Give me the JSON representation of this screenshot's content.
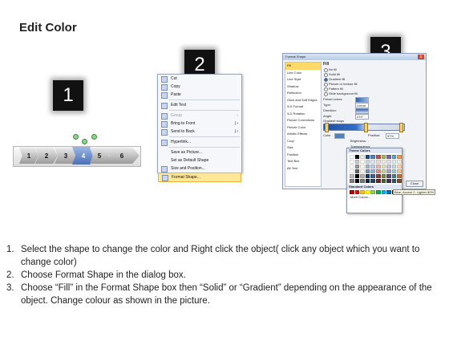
{
  "title": "Edit Color",
  "steps": [
    "1",
    "2",
    "3"
  ],
  "shapes": {
    "labels": [
      "1",
      "2",
      "3",
      "4",
      "5",
      "6"
    ]
  },
  "context_menu": {
    "items": [
      {
        "label": "Cut",
        "shortcut_letter": "t",
        "disabled": false
      },
      {
        "label": "Copy",
        "disabled": false
      },
      {
        "label": "Paste",
        "disabled": false
      },
      {
        "label": "Edit Text",
        "disabled": false
      },
      {
        "label": "Group",
        "disabled": true,
        "submenu": true
      },
      {
        "label": "Bring to Front",
        "disabled": false,
        "submenu": true
      },
      {
        "label": "Send to Back",
        "disabled": false,
        "submenu": true
      },
      {
        "label": "Hyperlink...",
        "disabled": false
      },
      {
        "label": "Save as Picture...",
        "disabled": false
      },
      {
        "label": "Set as Default Shape",
        "disabled": false
      },
      {
        "label": "Size and Position...",
        "disabled": false
      },
      {
        "label": "Format Shape...",
        "disabled": false,
        "highlighted": true
      }
    ]
  },
  "dialog": {
    "title": "Format Shape",
    "close": "x",
    "sidebar": [
      "Fill",
      "Line Color",
      "Line Style",
      "Shadow",
      "Reflection",
      "Glow and Soft Edges",
      "3-D Format",
      "3-D Rotation",
      "Picture Corrections",
      "Picture Color",
      "Artistic Effects",
      "Crop",
      "Size",
      "Position",
      "Text Box",
      "Alt Text"
    ],
    "fill_heading": "Fill",
    "fill_options": [
      {
        "label": "No fill",
        "on": false
      },
      {
        "label": "Solid fill",
        "on": false
      },
      {
        "label": "Gradient fill",
        "on": true
      },
      {
        "label": "Picture or texture fill",
        "on": false
      },
      {
        "label": "Pattern fill",
        "on": false
      },
      {
        "label": "Slide background fill",
        "on": false
      }
    ],
    "fields": [
      {
        "label": "Preset colors:",
        "value": ""
      },
      {
        "label": "Type:",
        "value": "Linear"
      },
      {
        "label": "Direction:",
        "value": ""
      },
      {
        "label": "Angle:",
        "value": "270°"
      }
    ],
    "gradient_stops_label": "Gradient stops",
    "color_label": "Color",
    "position_label": "Position:",
    "position_value": "57%",
    "brightness_label": "Brightness:",
    "transparency_label": "Transparency:",
    "rotate_label": "Rotate with shape",
    "close_button": "Close"
  },
  "palette": {
    "theme_label": "Theme Colors",
    "standard_label": "Standard Colors",
    "more_label": "More Colors...",
    "tooltip": "Blue, Accent 2, Lighter 80%",
    "theme_top": [
      "#ffffff",
      "#000000",
      "#eeece1",
      "#1f497d",
      "#4f81bd",
      "#c0504d",
      "#9bbb59",
      "#8064a2",
      "#4bacc6",
      "#f79646"
    ],
    "standard": [
      "#c00000",
      "#ff0000",
      "#ffc000",
      "#ffff00",
      "#92d050",
      "#00b050",
      "#00b0f0",
      "#0070c0",
      "#002060",
      "#7030a0"
    ]
  },
  "instructions": [
    {
      "num": "1.",
      "text": "Select the shape to change the color and Right click the object( click any object which you want to change color)"
    },
    {
      "num": "2.",
      "text": "Choose Format Shape in the dialog box."
    },
    {
      "num": "3.",
      "text": "Choose “Fill” in the Format Shape box then “Solid” or “Gradient” depending on the appearance of the object. Change colour as shown in the picture."
    }
  ]
}
